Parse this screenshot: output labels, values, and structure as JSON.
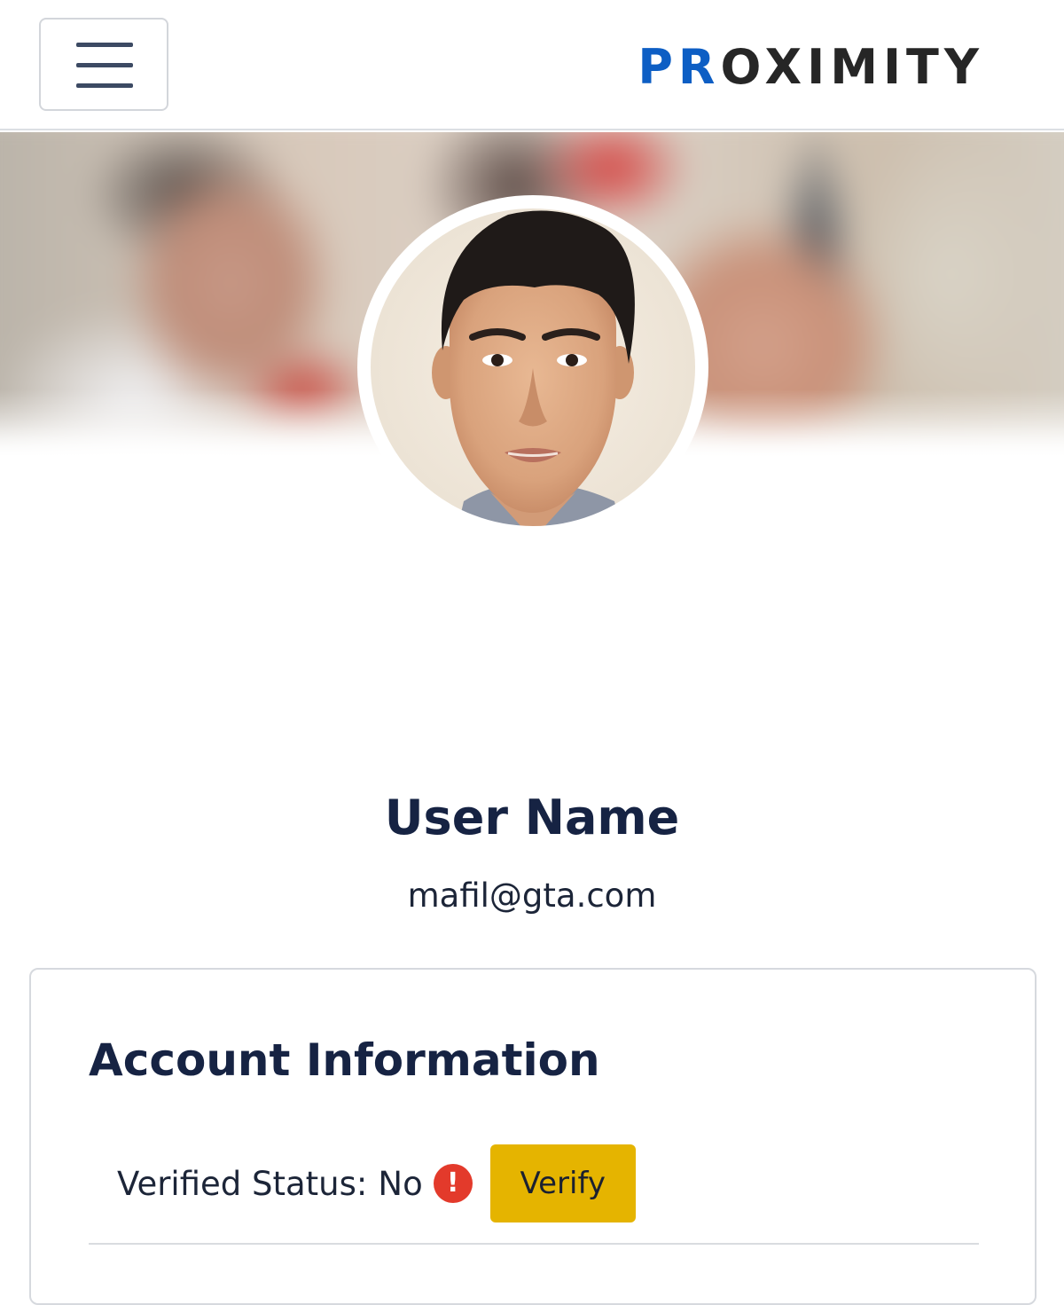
{
  "navbar": {
    "menu_icon": "hamburger-menu-icon",
    "brand_accent": "PR",
    "brand_rest": "OXIMITY",
    "brand_accent_color": "#0d5ec4"
  },
  "profile": {
    "banner": "blurred-cover-photo",
    "avatar": "profile-photo",
    "name": "User Name",
    "email": "mafil@gta.com"
  },
  "account_card": {
    "title": "Account Information",
    "verified_label": "Verified Status:",
    "verified_value": "No",
    "status_icon": "exclamation-circle-icon",
    "status_icon_color": "#e33a2b",
    "verify_button_label": "Verify",
    "verify_button_color": "#e5b400"
  }
}
